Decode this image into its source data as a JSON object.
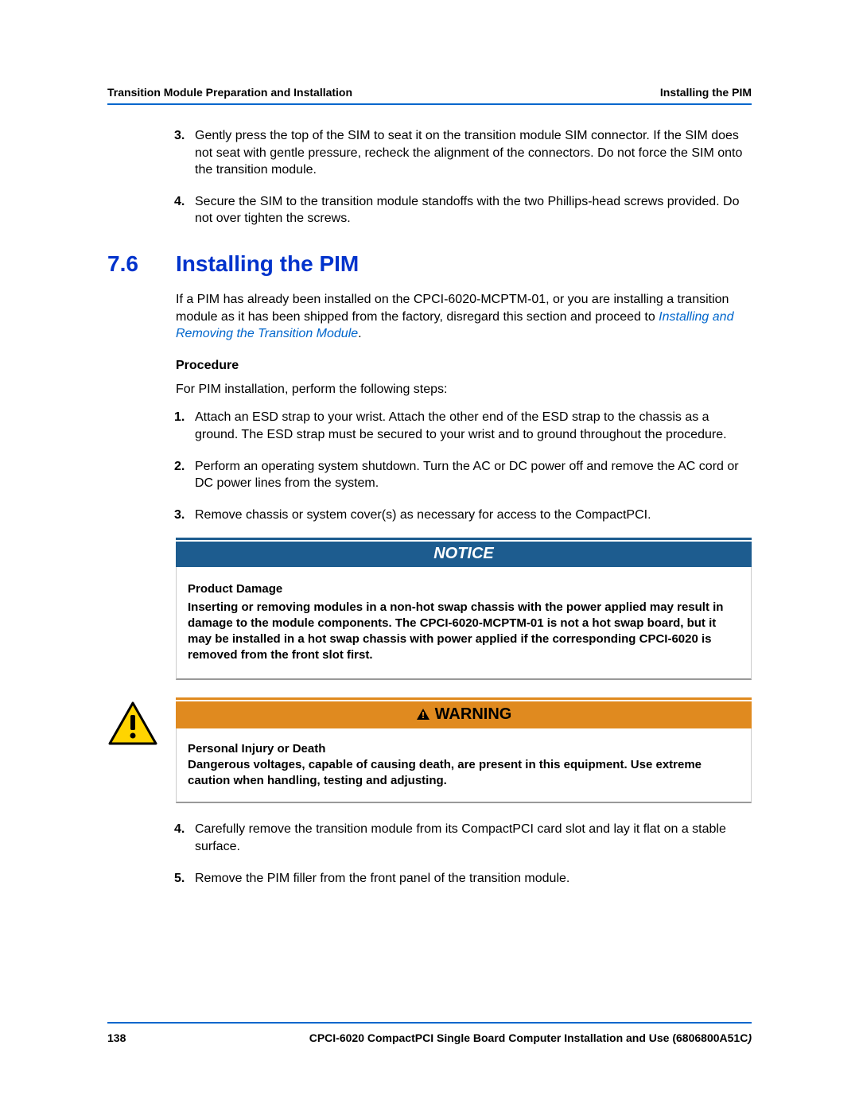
{
  "header": {
    "left": "Transition Module Preparation and Installation",
    "right": "Installing the PIM"
  },
  "top_steps": [
    {
      "num": "3.",
      "text": "Gently press the top of the SIM to seat it on the transition module SIM connector. If the SIM does not seat with gentle pressure, recheck the alignment of the connectors. Do not force the SIM onto the transition module."
    },
    {
      "num": "4.",
      "text": "Secure the SIM to the transition module standoffs with the two Phillips-head screws provided. Do not over tighten the screws."
    }
  ],
  "section": {
    "number": "7.6",
    "title": "Installing the PIM",
    "intro_pre": "If a PIM has already been installed on the CPCI-6020-MCPTM-01, or you are installing a transition module as it has been shipped from the factory, disregard this section and proceed to ",
    "intro_link": "Installing and Removing the Transition Module",
    "intro_post": "."
  },
  "procedure": {
    "heading": "Procedure",
    "lead": "For PIM installation, perform the following steps:",
    "steps_a": [
      {
        "num": "1.",
        "text": "Attach an ESD strap to your wrist. Attach the other end of the ESD strap to the chassis as a ground. The ESD strap must be secured to your wrist and to ground throughout the procedure."
      },
      {
        "num": "2.",
        "text": "Perform an operating system shutdown. Turn the AC or DC power off and remove the AC cord or DC power lines from the system."
      },
      {
        "num": "3.",
        "text": "Remove chassis or system cover(s) as necessary for access to the CompactPCI."
      }
    ],
    "steps_b": [
      {
        "num": "4.",
        "text": "Carefully remove the transition module from its CompactPCI card slot and lay it flat on a stable surface."
      },
      {
        "num": "5.",
        "text": "Remove the PIM filler from the front panel of the transition module."
      }
    ]
  },
  "notice": {
    "label": "NOTICE",
    "title": "Product Damage",
    "body": "Inserting or removing modules in a non-hot swap chassis with the power applied may result in damage to the module components. The CPCI-6020-MCPTM-01 is not a hot swap board, but it may be installed in a hot swap chassis with power applied if the corresponding CPCI-6020 is removed from the front slot first."
  },
  "warning": {
    "label": "WARNING",
    "title": "Personal Injury or Death",
    "body": "Dangerous voltages, capable of causing death, are present in this equipment. Use extreme caution when handling, testing and adjusting."
  },
  "footer": {
    "page": "138",
    "doc_title": "CPCI-6020 CompactPCI Single Board Computer Installation and Use (6806800A51C",
    "doc_close": ")"
  }
}
